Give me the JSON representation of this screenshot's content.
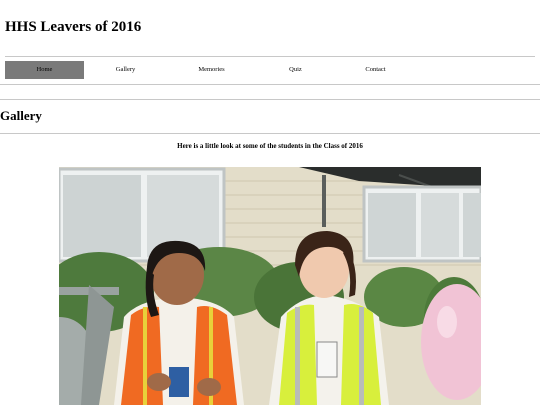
{
  "site": {
    "title": "HHS Leavers of 2016"
  },
  "nav": {
    "items": [
      {
        "label": "Home",
        "active": true
      },
      {
        "label": "Gallery",
        "active": false
      },
      {
        "label": "Memories",
        "active": false
      },
      {
        "label": "Quiz",
        "active": false
      },
      {
        "label": "Contact",
        "active": false
      }
    ]
  },
  "gallery": {
    "heading": "Gallery",
    "intro": "Here is a little look at some of the students in the Class of 2016"
  },
  "colors": {
    "nav_active_bg": "#7a7a7a",
    "divider": "#c8c8c8"
  }
}
